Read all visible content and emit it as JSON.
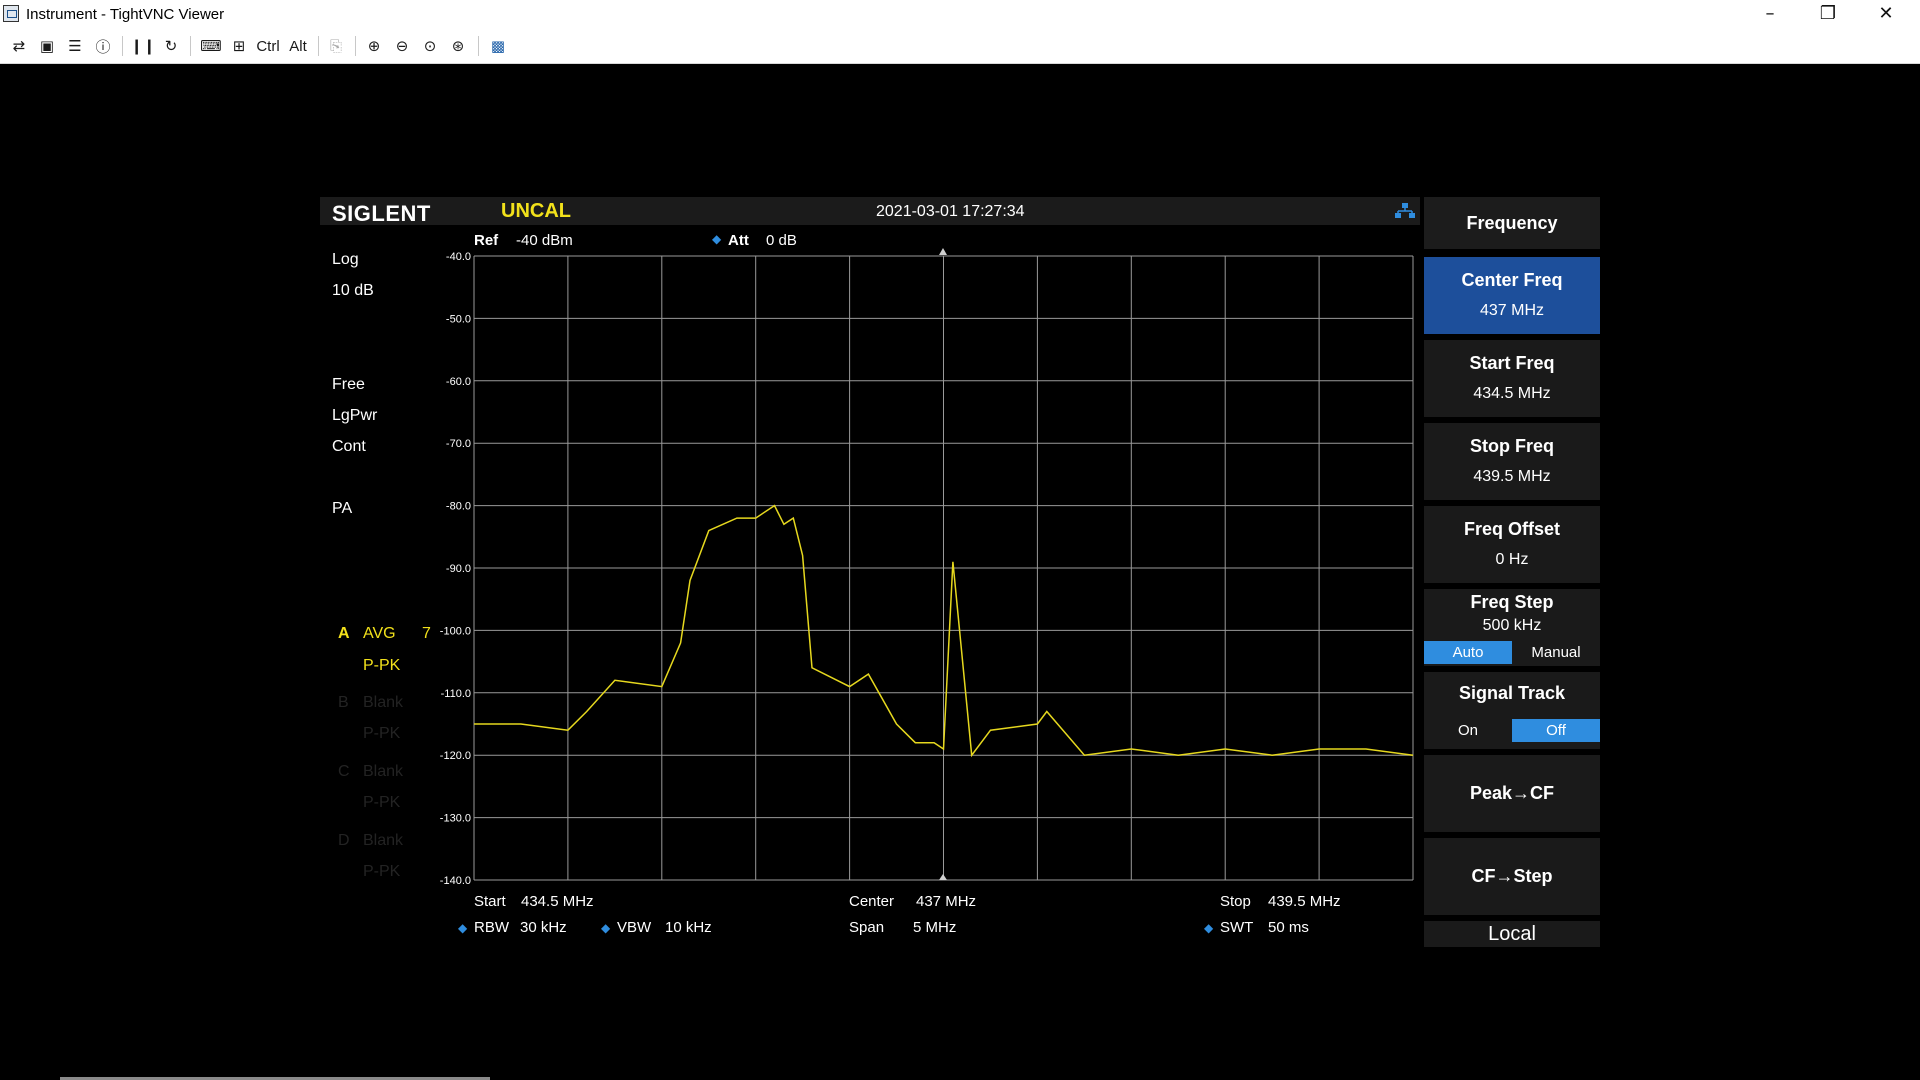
{
  "window": {
    "title": "Instrument - TightVNC Viewer",
    "minimize": "–",
    "maximize": "❐",
    "close": "✕"
  },
  "toolbar": {
    "ctrl_label": "Ctrl",
    "alt_label": "Alt"
  },
  "analyzer": {
    "brand": "SIGLENT",
    "status": "UNCAL",
    "datetime": "2021-03-01 17:27:34",
    "ref_label": "Ref",
    "ref_value": "-40 dBm",
    "att_label": "Att",
    "att_value": "0 dB",
    "scale_type": "Log",
    "scale_div": "10 dB",
    "trigger": "Free",
    "detector_mode": "LgPwr",
    "sweep_mode": "Cont",
    "preamp": "PA",
    "traces": [
      {
        "letter": "A",
        "mode": "AVG",
        "count": "7",
        "detector": "P-PK",
        "active": true
      },
      {
        "letter": "B",
        "mode": "Blank",
        "detector": "P-PK",
        "active": false
      },
      {
        "letter": "C",
        "mode": "Blank",
        "detector": "P-PK",
        "active": false
      },
      {
        "letter": "D",
        "mode": "Blank",
        "detector": "P-PK",
        "active": false
      }
    ],
    "start_label": "Start",
    "start_value": "434.5 MHz",
    "center_label": "Center",
    "center_value": "437 MHz",
    "stop_label": "Stop",
    "stop_value": "439.5 MHz",
    "rbw_label": "RBW",
    "rbw_value": "30 kHz",
    "vbw_label": "VBW",
    "vbw_value": "10 kHz",
    "span_label": "Span",
    "span_value": "5 MHz",
    "swt_label": "SWT",
    "swt_value": "50 ms",
    "colors": {
      "trace": "#e6d81e",
      "grid": "#9a9a9a",
      "accent": "#1d4f9b",
      "toggle_on": "#2f8ddf",
      "uncal": "#f2e11b"
    }
  },
  "softkeys": {
    "menu_title": "Frequency",
    "center_freq": {
      "label": "Center Freq",
      "value": "437 MHz"
    },
    "start_freq": {
      "label": "Start Freq",
      "value": "434.5 MHz"
    },
    "stop_freq": {
      "label": "Stop Freq",
      "value": "439.5 MHz"
    },
    "freq_offset": {
      "label": "Freq Offset",
      "value": "0 Hz"
    },
    "freq_step": {
      "label": "Freq Step",
      "value": "500 kHz",
      "auto": "Auto",
      "manual": "Manual",
      "selected": "Auto"
    },
    "signal_track": {
      "label": "Signal Track",
      "on": "On",
      "off": "Off",
      "selected": "Off"
    },
    "peak_cf": "Peak→CF",
    "cf_step": "CF→Step",
    "local": "Local"
  },
  "chart_data": {
    "type": "line",
    "ylim": [
      -140,
      -40
    ],
    "xlim": [
      434.5,
      439.5
    ],
    "y_ticks": [
      "-40.0",
      "-50.0",
      "-60.0",
      "-70.0",
      "-80.0",
      "-90.0",
      "-100.0",
      "-110.0",
      "-120.0",
      "-130.0",
      "-140.0"
    ],
    "grid": true,
    "series": [
      {
        "x": [
          434.5,
          434.75,
          435.0,
          435.1,
          435.25,
          435.5,
          435.6,
          435.65,
          435.75,
          435.9,
          436.0,
          436.1,
          436.15,
          436.2,
          436.25,
          436.3,
          436.5,
          436.6,
          436.75,
          436.85,
          436.95,
          437.0,
          437.05,
          437.15,
          437.25,
          437.5,
          437.55,
          437.75,
          438.0,
          438.25,
          438.5,
          438.75,
          439.0,
          439.25,
          439.5
        ],
        "y": [
          -115,
          -115,
          -116,
          -113,
          -108,
          -109,
          -102,
          -92,
          -84,
          -82,
          -82,
          -80,
          -83,
          -82,
          -88,
          -106,
          -109,
          -107,
          -115,
          -118,
          -118,
          -119,
          -89,
          -120,
          -116,
          -115,
          -113,
          -120,
          -119,
          -120,
          -119,
          -120,
          -119,
          -119,
          -120
        ]
      }
    ]
  }
}
